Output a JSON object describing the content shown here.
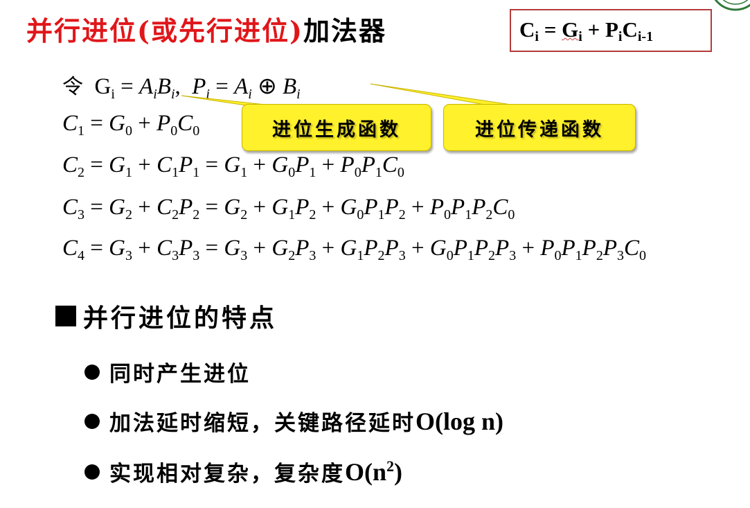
{
  "title": {
    "red": "并行进位(或先行进位)",
    "black": "加法器"
  },
  "formula_box": {
    "C": "C",
    "i1": "i",
    "eq": " = ",
    "G": "G",
    "i2": "i",
    "plus": " + ",
    "P": "P",
    "i3": "i",
    "C2": "C",
    "sub": "i-1"
  },
  "definition": {
    "prefix": "令",
    "G": "G",
    "gi": "i",
    "eq1": " = ",
    "A1": "A",
    "a1": "i",
    "B1": "B",
    "b1": "i",
    "sep": ",",
    "P": "P",
    "pi": "i",
    "eq2": " = ",
    "A2": "A",
    "a2": "i",
    "xor": "⊕",
    "B2": "B",
    "b2": "i"
  },
  "equations": {
    "c1": [
      [
        "C",
        "1"
      ],
      [
        " = ",
        ""
      ],
      [
        "G",
        "0"
      ],
      [
        " + ",
        ""
      ],
      [
        "P",
        "0"
      ],
      [
        "C",
        "0"
      ]
    ],
    "c2": [
      [
        "C",
        "2"
      ],
      [
        " = ",
        ""
      ],
      [
        "G",
        "1"
      ],
      [
        " + ",
        ""
      ],
      [
        "C",
        "1"
      ],
      [
        "P",
        "1"
      ],
      [
        " = ",
        ""
      ],
      [
        "G",
        "1"
      ],
      [
        " + ",
        ""
      ],
      [
        "G",
        "0"
      ],
      [
        "P",
        "1"
      ],
      [
        " + ",
        ""
      ],
      [
        "P",
        "0"
      ],
      [
        "P",
        "1"
      ],
      [
        "C",
        "0"
      ]
    ],
    "c3": [
      [
        "C",
        "3"
      ],
      [
        " = ",
        ""
      ],
      [
        "G",
        "2"
      ],
      [
        " + ",
        ""
      ],
      [
        "C",
        "2"
      ],
      [
        "P",
        "2"
      ],
      [
        " = ",
        ""
      ],
      [
        "G",
        "2"
      ],
      [
        " + ",
        ""
      ],
      [
        "G",
        "1"
      ],
      [
        "P",
        "2"
      ],
      [
        " + ",
        ""
      ],
      [
        "G",
        "0"
      ],
      [
        "P",
        "1"
      ],
      [
        "P",
        "2"
      ],
      [
        " + ",
        ""
      ],
      [
        "P",
        "0"
      ],
      [
        "P",
        "1"
      ],
      [
        "P",
        "2"
      ],
      [
        "C",
        "0"
      ]
    ],
    "c4": [
      [
        "C",
        "4"
      ],
      [
        " = ",
        ""
      ],
      [
        "G",
        "3"
      ],
      [
        " + ",
        ""
      ],
      [
        "C",
        "3"
      ],
      [
        "P",
        "3"
      ],
      [
        " = ",
        ""
      ],
      [
        "G",
        "3"
      ],
      [
        " + ",
        ""
      ],
      [
        "G",
        "2"
      ],
      [
        "P",
        "3"
      ],
      [
        " + ",
        ""
      ],
      [
        "G",
        "1"
      ],
      [
        "P",
        "2"
      ],
      [
        "P",
        "3"
      ],
      [
        " + ",
        ""
      ],
      [
        "G",
        "0"
      ],
      [
        "P",
        "1"
      ],
      [
        "P",
        "2"
      ],
      [
        "P",
        "3"
      ],
      [
        " + ",
        ""
      ],
      [
        "P",
        "0"
      ],
      [
        "P",
        "1"
      ],
      [
        "P",
        "2"
      ],
      [
        "P",
        "3"
      ],
      [
        "C",
        "0"
      ]
    ]
  },
  "callouts": {
    "generate": "进位生成函数",
    "propagate": "进位传递函数",
    "fill_color": "#fff12b"
  },
  "section": {
    "heading": "并行进位的特点"
  },
  "bullets": {
    "b1": "同时产生进位",
    "b2_text": "加法延时缩短，关键路径延时",
    "b2_latin": "O(log n)",
    "b3_text": "实现相对复杂，复杂度",
    "b3_latin_pre": "O(n",
    "b3_sup": "2",
    "b3_latin_post": ")"
  },
  "colors": {
    "title_red": "#e0161a",
    "box_border": "#b43a3a"
  }
}
